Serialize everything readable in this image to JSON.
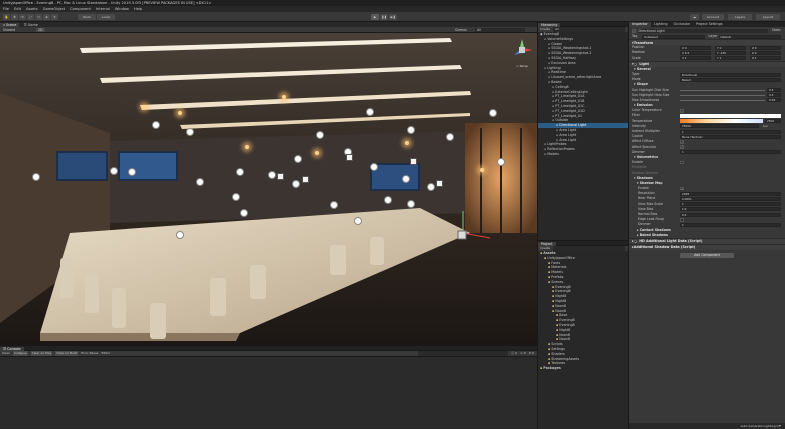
{
  "window": {
    "title": "UnityJapanOffice - Evening8 - PC, Mac & Linux Standalone - Unity 2019.3.0f3 [PREVIEW PACKAGES IN USE] <DX11>"
  },
  "menu": [
    "File",
    "Edit",
    "Assets",
    "GameObject",
    "Component",
    "Internal",
    "Window",
    "Help"
  ],
  "toolbar": {
    "pivot": "Pivot",
    "local": "Local",
    "account": "Account",
    "layers": "Layers",
    "layout": "Layout"
  },
  "scene_tabs": {
    "scene": "Scene",
    "game": "Game"
  },
  "scene_toolbar": {
    "shading": "Shaded",
    "mode": "2D",
    "gizmos": "Gizmos",
    "search": "All"
  },
  "gizmo": {
    "label": "< Persp"
  },
  "hierarchy": {
    "tab": "Hierarchy",
    "create": "Create",
    "search": "All",
    "items": [
      {
        "label": "Evening8",
        "depth": 0,
        "selected": false
      },
      {
        "label": "VolumeSettings",
        "depth": 1,
        "selected": false
      },
      {
        "label": "Global",
        "depth": 2,
        "selected": false
      },
      {
        "label": "SSGIA_Weakeningshot-1",
        "depth": 2,
        "selected": false
      },
      {
        "label": "SSGIA_Weakeningshot-2",
        "depth": 2,
        "selected": false
      },
      {
        "label": "SSGIA_Halfway",
        "depth": 2,
        "selected": false
      },
      {
        "label": "Exclusion Area",
        "depth": 2,
        "selected": false
      },
      {
        "label": "Lighting",
        "depth": 1,
        "selected": false
      },
      {
        "label": "Realtime",
        "depth": 2,
        "selected": false
      },
      {
        "label": "Unused_scene_other.lightArea",
        "depth": 2,
        "selected": false
      },
      {
        "label": "Baked",
        "depth": 2,
        "selected": false
      },
      {
        "label": "Ceiling8",
        "depth": 3,
        "selected": false
      },
      {
        "label": "ExteriorCeilingLight",
        "depth": 3,
        "selected": false
      },
      {
        "label": "PT_Limelight_01A",
        "depth": 3,
        "selected": false
      },
      {
        "label": "PT_Limelight_01B",
        "depth": 3,
        "selected": false
      },
      {
        "label": "PT_Limelight_01C",
        "depth": 3,
        "selected": false
      },
      {
        "label": "PT_Limelight_01D",
        "depth": 3,
        "selected": false
      },
      {
        "label": "PT_Limelight_01",
        "depth": 3,
        "selected": false
      },
      {
        "label": "Outside",
        "depth": 3,
        "selected": false
      },
      {
        "label": "Directional Light",
        "depth": 4,
        "selected": true
      },
      {
        "label": "Area Light",
        "depth": 4,
        "selected": false
      },
      {
        "label": "Area Light",
        "depth": 4,
        "selected": false
      },
      {
        "label": "Area Light",
        "depth": 4,
        "selected": false
      },
      {
        "label": "LightProbes",
        "depth": 1,
        "selected": false
      },
      {
        "label": "ReflectionProbes",
        "depth": 1,
        "selected": false
      },
      {
        "label": "Models",
        "depth": 1,
        "selected": false
      }
    ]
  },
  "project": {
    "tab": "Project",
    "create": "Create",
    "items": [
      {
        "label": "Assets",
        "depth": 0
      },
      {
        "label": "UnityJapanOffice",
        "depth": 1
      },
      {
        "label": "Fonts",
        "depth": 2
      },
      {
        "label": "Materials",
        "depth": 2
      },
      {
        "label": "Models",
        "depth": 2
      },
      {
        "label": "Prefabs",
        "depth": 2
      },
      {
        "label": "Scenes",
        "depth": 2
      },
      {
        "label": "Evening8",
        "depth": 3
      },
      {
        "label": "Evening8",
        "depth": 3
      },
      {
        "label": "Night8",
        "depth": 3
      },
      {
        "label": "Night8",
        "depth": 3
      },
      {
        "label": "Noon8",
        "depth": 3
      },
      {
        "label": "Noon8",
        "depth": 3
      },
      {
        "label": "Base",
        "depth": 4
      },
      {
        "label": "Evening8",
        "depth": 4
      },
      {
        "label": "Evening8",
        "depth": 4
      },
      {
        "label": "Night8",
        "depth": 4
      },
      {
        "label": "Noon8",
        "depth": 4
      },
      {
        "label": "Noon8",
        "depth": 4
      },
      {
        "label": "Scripts",
        "depth": 2
      },
      {
        "label": "Settings",
        "depth": 2
      },
      {
        "label": "Shaders",
        "depth": 2
      },
      {
        "label": "StreamingAssets",
        "depth": 2
      },
      {
        "label": "Textures",
        "depth": 2
      },
      {
        "label": "Packages",
        "depth": 0
      }
    ]
  },
  "inspector": {
    "tabs": [
      "Inspector",
      "Lighting",
      "Occlusion",
      "Project Settings"
    ],
    "object_name": "Directional Light",
    "static": "Static",
    "tag_label": "Tag",
    "tag_value": "Untagged",
    "layer_label": "Layer",
    "layer_value": "Default",
    "transform": {
      "title": "Transform",
      "rows": [
        {
          "label": "Position",
          "x": "X 0",
          "y": "Y 0",
          "z": "Z 0"
        },
        {
          "label": "Rotation",
          "x": "X 6.5",
          "y": "Y -130",
          "z": "Z 0"
        },
        {
          "label": "Scale",
          "x": "X 1",
          "y": "Y 1",
          "z": "Z 1"
        }
      ]
    },
    "light": {
      "title": "Light",
      "general": "General",
      "type_label": "Type",
      "type_value": "Directional",
      "mode_label": "Mode",
      "mode_value": "Baked",
      "shape": "Shape",
      "shape_rows": [
        {
          "label": "Sun Highlight Disk Size",
          "value": "0.5"
        },
        {
          "label": "Sun Highlight Halo Size",
          "value": "0.5"
        },
        {
          "label": "Max Smoothness",
          "value": "0.99"
        }
      ],
      "emission": "Emission",
      "color_temp_label": "Color Temperature",
      "filter_label": "Filter",
      "temperature_label": "Temperature",
      "temperature_value": "2500",
      "intensity_label": "Intensity",
      "intensity_value": "25000",
      "intensity_unit": "Lux",
      "indirect_label": "Indirect Multiplier",
      "indirect_value": "1",
      "cookie_label": "Cookie",
      "cookie_value": "None (Texture)",
      "affect_diffuse": "Affect Diffuse",
      "affect_specular": "Affect Specular",
      "dimmer_label": "Dimmer",
      "dimmer_value": "1",
      "volumetrics": "Volumetrics",
      "vol_enable": "Enable",
      "vol_multiplier": "Multiplier",
      "vol_shadow_dimmer": "Shadow Dimmer",
      "shadows": "Shadows",
      "shadow_map": "Shadow Map",
      "sm_enable": "Enable",
      "resolution_label": "Resolution",
      "resolution_value": "2048",
      "near_plane_label": "Near Plane",
      "near_plane_value": "0.0001",
      "view_bias_scale_label": "View Bias Scale",
      "view_bias_scale_value": "1",
      "view_bias_label": "View Bias",
      "view_bias_value": "1.0",
      "normal_bias_label": "Normal Bias",
      "normal_bias_value": "0.5",
      "edge_leak_label": "Edge Leak Fixup",
      "dimmer2_label": "Dimmer",
      "dimmer2_value": "1",
      "contact_shadows": "Contact Shadows",
      "baked_shadows": "Baked Shadows"
    },
    "components": [
      "HD Additional Light Data (Script)",
      "Additional Shadow Data (Script)"
    ],
    "add_component": "Add Component"
  },
  "console": {
    "tab": "Console",
    "buttons": [
      "Clear",
      "Collapse",
      "Clear on Play",
      "Clear on Build",
      "Error Pause",
      "Editor"
    ],
    "counts": [
      "0",
      "0",
      "0"
    ]
  },
  "status": {
    "text": "Auto Generate Lighting Off"
  },
  "colors": {
    "selection": "#2c5d87",
    "panel": "#282828",
    "toolbar": "#383838",
    "accent_filter": "#ff8a2a"
  }
}
